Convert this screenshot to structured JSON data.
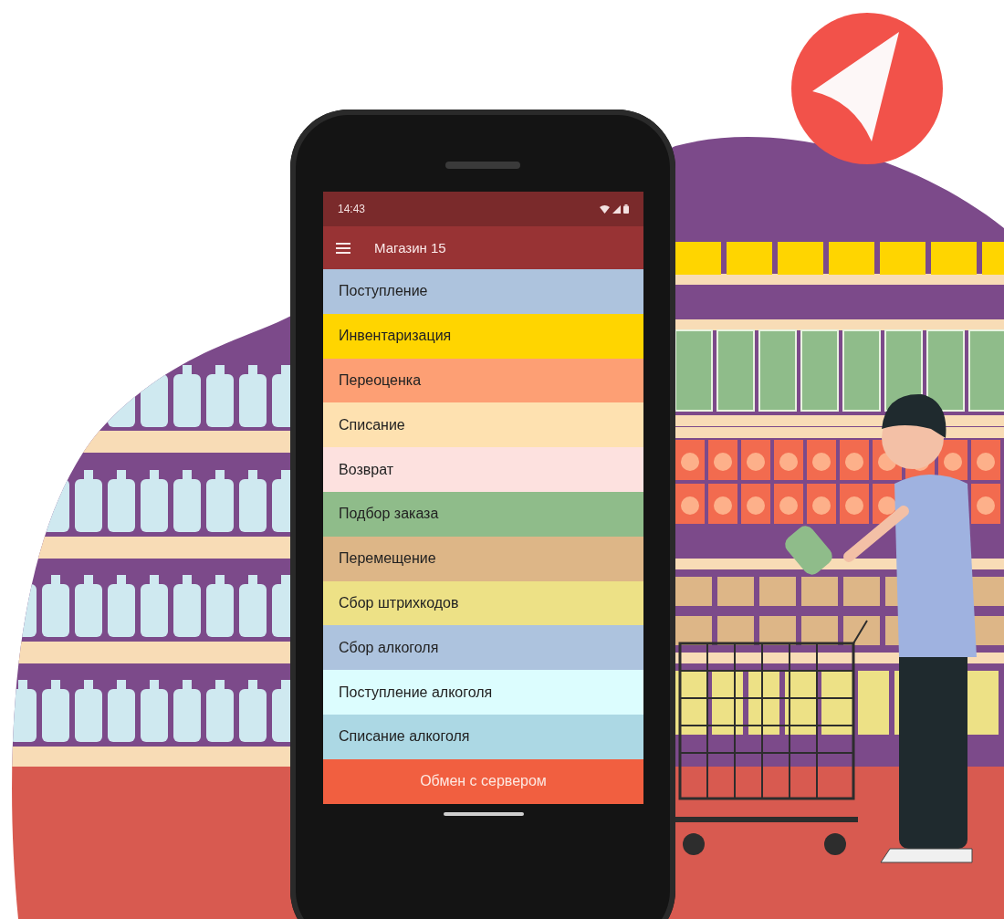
{
  "status_bar": {
    "time": "14:43"
  },
  "app_bar": {
    "title": "Магазин 15"
  },
  "menu": [
    {
      "label": "Поступление",
      "color": "#adc3dd"
    },
    {
      "label": "Инвентаризация",
      "color": "#ffd500"
    },
    {
      "label": "Переоценка",
      "color": "#fd9f74"
    },
    {
      "label": "Списание",
      "color": "#fee1b0"
    },
    {
      "label": "Возврат",
      "color": "#fde1df"
    },
    {
      "label": "Подбор заказа",
      "color": "#8fbc8a"
    },
    {
      "label": "Перемещение",
      "color": "#ddb687"
    },
    {
      "label": "Сбор штрихкодов",
      "color": "#ede186"
    },
    {
      "label": "Сбор алкоголя",
      "color": "#adc3de"
    },
    {
      "label": "Поступление алкоголя",
      "color": "#dcfdfe"
    },
    {
      "label": "Списание алкоголя",
      "color": "#acd8e4"
    }
  ],
  "footer_button": {
    "label": "Обмен с сервером"
  }
}
